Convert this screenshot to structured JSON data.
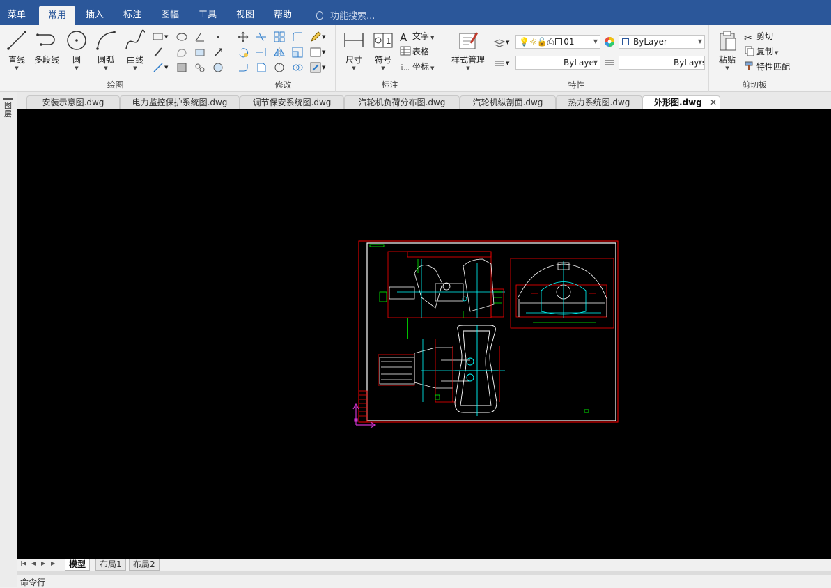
{
  "menu": {
    "tabs": [
      "菜单",
      "常用",
      "插入",
      "标注",
      "图幅",
      "工具",
      "视图",
      "帮助"
    ],
    "active_tab": "常用",
    "search_placeholder": "功能搜索..."
  },
  "ribbon": {
    "draw": {
      "label": "绘图",
      "line": "直线",
      "polyline": "多段线",
      "circle": "圆",
      "arc": "圆弧",
      "spline": "曲线"
    },
    "modify": {
      "label": "修改"
    },
    "annotate": {
      "label": "标注",
      "dimension": "尺寸",
      "symbol": "符号",
      "text": "文字",
      "table": "表格",
      "coordinate": "坐标"
    },
    "properties": {
      "label": "特性",
      "style_manager": "样式管理",
      "layer_value": "01",
      "color_value": "ByLayer",
      "linetype_value": "ByLayer",
      "lineweight_value": "ByLaye"
    },
    "clipboard": {
      "label": "剪切板",
      "paste": "粘贴",
      "cut": "剪切",
      "copy": "复制",
      "match_properties": "特性匹配"
    }
  },
  "documents": {
    "tabs": [
      "安装示意图.dwg",
      "电力监控保护系统图.dwg",
      "调节保安系统图.dwg",
      "汽轮机负荷分布图.dwg",
      "汽轮机纵剖面.dwg",
      "热力系统图.dwg",
      "外形图.dwg"
    ],
    "active": "外形图.dwg"
  },
  "side_panel": {
    "label": "图层"
  },
  "layouts": {
    "tabs": [
      "模型",
      "布局1",
      "布局2"
    ],
    "active": "模型"
  },
  "command": {
    "label": "命令行"
  },
  "colors": {
    "menu_bar": "#2b579a",
    "canvas": "#000000",
    "frame_red": "#ff0000",
    "drawing_white": "#ffffff",
    "drawing_cyan": "#00ffff",
    "ucs_magenta": "#cc33cc"
  }
}
